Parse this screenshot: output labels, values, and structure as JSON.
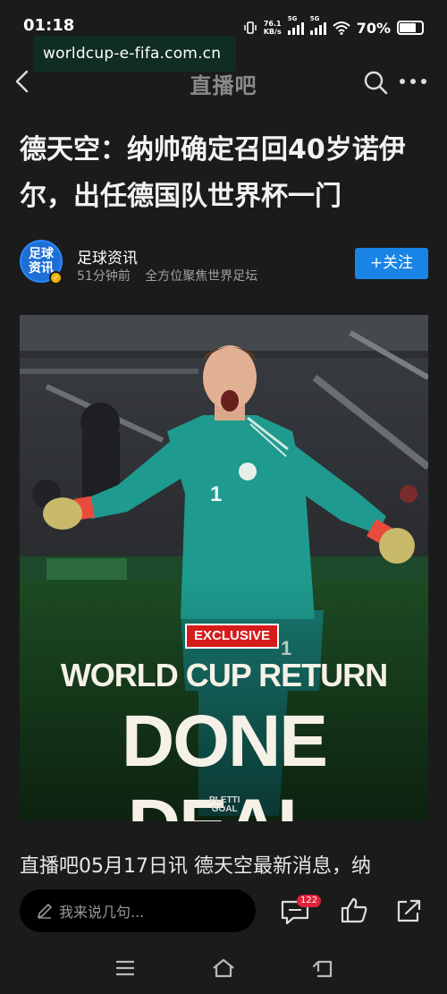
{
  "status_bar": {
    "time": "01:18",
    "net_speed_value": "76.1",
    "net_speed_unit": "KB/s",
    "sim1_label": "5G",
    "sim2_label": "5G",
    "battery_percent": "70%",
    "battery_level": 0.7
  },
  "watermark": {
    "text": "worldcup-e-fifa.com.cn"
  },
  "nav": {
    "title": "直播吧"
  },
  "article": {
    "headline": "德天空：纳帅确定召回40岁诺伊尔，出任德国队世界杯一门",
    "author": {
      "name": "足球资讯",
      "avatar_text_line1": "足球",
      "avatar_text_line2": "资讯",
      "time_ago": "51分钟前",
      "tagline": "全方位聚焦世界足坛"
    },
    "follow_label": "+关注",
    "hero": {
      "badge": "EXCLUSIVE",
      "line1": "WORLD CUP RETURN",
      "line2": "DONE DEAL",
      "credit_line1": "PLETTI",
      "credit_line2": "GOAL",
      "jersey_number": "1"
    },
    "body_preview": "直播吧05月17日讯 德天空最新消息，纳"
  },
  "comment_bar": {
    "placeholder": "我来说几句...",
    "comment_count": "122"
  },
  "colors": {
    "background": "#1b1b1b",
    "follow_blue": "#1a84e6",
    "badge_red": "#e0223a",
    "jersey_teal": "#1f9a8e"
  }
}
